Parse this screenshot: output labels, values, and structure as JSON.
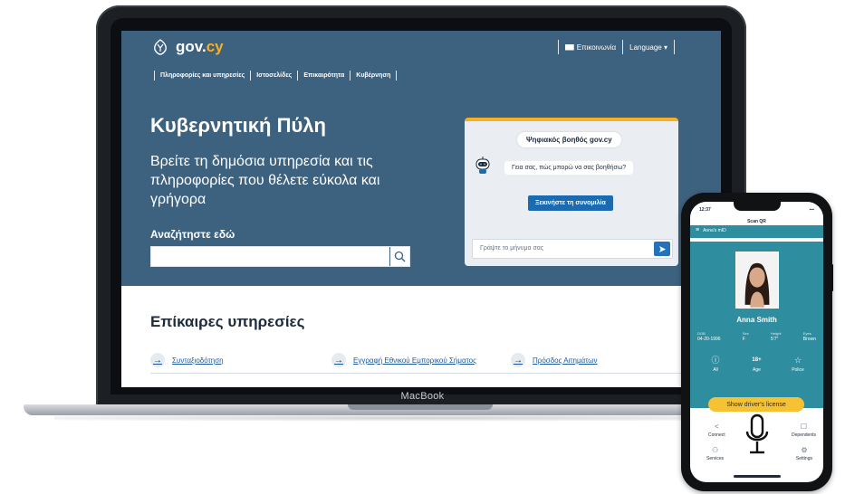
{
  "laptop": {
    "brand": "MacBook"
  },
  "site": {
    "logo": {
      "main": "gov.",
      "accent": "cy"
    },
    "top_links": {
      "contact": "Επικοινωνία",
      "language": "Language ▾"
    },
    "nav": [
      "Πληροφορίες και υπηρεσίες",
      "Ιστοσελίδες",
      "Επικαιρότητα",
      "Κυβέρνηση"
    ],
    "hero": {
      "title": "Κυβερνητική Πύλη",
      "subtitle": "Βρείτε τη δημόσια υπηρεσία και τις πληροφορίες που θέλετε εύκολα και γρήγορα"
    },
    "search": {
      "label": "Αναζήτηστε εδώ",
      "value": "",
      "icon": "search-icon"
    },
    "chat": {
      "title": "Ψηφιακός βοηθός gov.cy",
      "bot_message": "Γεια σας, πώς μπορώ να σας βοηθήσω?",
      "start_button": "Ξεκινήστε τη συνομιλία",
      "input_placeholder": "Γράψτε το μήνυμα σας"
    },
    "services": {
      "title": "Επίκαιρες υπηρεσίες",
      "links": [
        "Συνταξιοδότηση",
        "Εγγραφή Εθνικού Εμπορικού Σήματος",
        "Πρόσδος Αιτημάτων"
      ]
    },
    "colors": {
      "primary": "#3d6280",
      "accent": "#f6b026",
      "button": "#1c6bb0"
    }
  },
  "phone": {
    "status": {
      "time": "12:37",
      "signals": "▪▪▪"
    },
    "header": {
      "title": "Scan QR",
      "menu_label": "Anna's mID"
    },
    "person": {
      "name": "Anna Smith"
    },
    "facts": [
      {
        "label": "DOB",
        "value": "04-20-1996"
      },
      {
        "label": "Sex",
        "value": "F"
      },
      {
        "label": "Height",
        "value": "5'7\""
      },
      {
        "label": "Eyes",
        "value": "Brown"
      }
    ],
    "badges": [
      {
        "icon": "info-icon",
        "label": "All"
      },
      {
        "icon": "18plus-icon",
        "glyph": "18+",
        "label": "Age"
      },
      {
        "icon": "star-icon",
        "label": "Police"
      }
    ],
    "license_button": "Show driver's license",
    "grid": [
      {
        "icon": "share-icon",
        "label": "Connect"
      },
      {
        "icon": "dependents-icon",
        "label": "Dependents"
      },
      {
        "icon": "services-icon",
        "label": "Services"
      },
      {
        "icon": "settings-icon",
        "label": "Settings"
      }
    ],
    "colors": {
      "teal": "#2f8da0",
      "button": "#f6c234"
    }
  }
}
